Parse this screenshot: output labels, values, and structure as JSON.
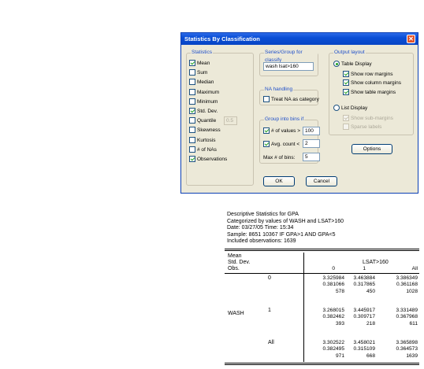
{
  "dialog": {
    "title": "Statistics By Classification",
    "statistics": {
      "title": "Statistics",
      "items": [
        {
          "label": "Mean",
          "checked": true
        },
        {
          "label": "Sum",
          "checked": false
        },
        {
          "label": "Median",
          "checked": false
        },
        {
          "label": "Maximum",
          "checked": false
        },
        {
          "label": "Minimum",
          "checked": false
        },
        {
          "label": "Std. Dev.",
          "checked": true
        },
        {
          "label": "Quantile",
          "checked": false,
          "value": "0.5"
        },
        {
          "label": "Skewness",
          "checked": false
        },
        {
          "label": "Kurtosis",
          "checked": false
        },
        {
          "label": "# of NAs",
          "checked": false
        },
        {
          "label": "Observations",
          "checked": true
        }
      ]
    },
    "series": {
      "title": "Series/Group for classify",
      "value": "wash lsat>160"
    },
    "na": {
      "title": "NA handling",
      "label": "Treat NA as category",
      "checked": false
    },
    "bins": {
      "title": "Group into bins if",
      "values_label": "# of values >",
      "values_checked": true,
      "values_value": "100",
      "count_label": "Avg. count <",
      "count_checked": true,
      "count_value": "2",
      "max_label": "Max # of bins:",
      "max_value": "5"
    },
    "output": {
      "title": "Output layout",
      "table_label": "Table Display",
      "table_selected": true,
      "row_margins": "Show row margins",
      "col_margins": "Show column margins",
      "table_margins": "Show table margins",
      "list_label": "List Display",
      "list_selected": false,
      "sub_margins": "Show sub-margins",
      "sparse": "Sparse labels"
    },
    "options_label": "Options",
    "ok_label": "OK",
    "cancel_label": "Cancel"
  },
  "output": {
    "header": [
      "Descriptive Statistics for GPA",
      "Categorized by values of WASH and LSAT>160",
      "Date: 03/27/05   Time: 15:34",
      "Sample: 8651 10367 IF GPA>1 AND GPA<5",
      "Included observations: 1639"
    ],
    "stub_labels": [
      "Mean",
      "Std. Dev.",
      "Obs."
    ],
    "col_group": "LSAT>160",
    "col_headers": [
      "0",
      "1",
      "All"
    ],
    "row_var": "WASH",
    "rows": [
      {
        "label": "0",
        "cells": [
          [
            "3.325984",
            "3.463884",
            "3.386349"
          ],
          [
            "0.381066",
            "0.317865",
            "0.361168"
          ],
          [
            "578",
            "450",
            "1028"
          ]
        ]
      },
      {
        "label": "1",
        "cells": [
          [
            "3.268015",
            "3.445917",
            "3.331489"
          ],
          [
            "0.382462",
            "0.309717",
            "0.367968"
          ],
          [
            "393",
            "218",
            "611"
          ]
        ]
      },
      {
        "label": "All",
        "cells": [
          [
            "3.302522",
            "3.458021",
            "3.365898"
          ],
          [
            "0.382495",
            "0.315109",
            "0.364573"
          ],
          [
            "971",
            "668",
            "1639"
          ]
        ]
      }
    ]
  }
}
